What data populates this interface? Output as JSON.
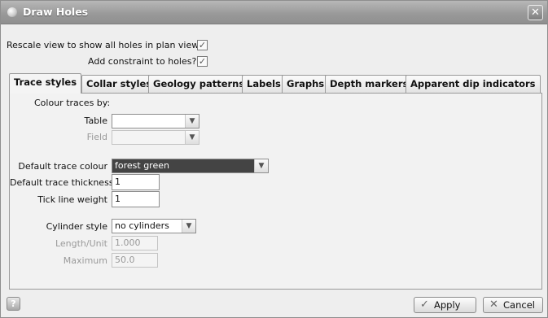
{
  "window": {
    "title": "Draw Holes",
    "close_glyph": "✕"
  },
  "options": {
    "rescale_label": "Rescale view to show all holes in plan view?",
    "rescale_checked": true,
    "constraint_label": "Add constraint to holes?",
    "constraint_checked": true,
    "check_glyph": "✓"
  },
  "tabs": [
    {
      "label": "Trace styles",
      "active": true
    },
    {
      "label": "Collar styles",
      "active": false
    },
    {
      "label": "Geology patterns",
      "active": false
    },
    {
      "label": "Labels",
      "active": false
    },
    {
      "label": "Graphs",
      "active": false
    },
    {
      "label": "Depth markers",
      "active": false
    },
    {
      "label": "Apparent dip indicators",
      "active": false
    }
  ],
  "trace": {
    "colour_by_label": "Colour traces by:",
    "table_label": "Table",
    "table_value": "",
    "field_label": "Field",
    "field_value": "",
    "default_colour_label": "Default trace colour",
    "default_colour_value": "forest green",
    "thickness_label": "Default trace thickness",
    "thickness_value": "1",
    "tick_label": "Tick line weight",
    "tick_value": "1",
    "cylinder_label": "Cylinder style",
    "cylinder_value": "no cylinders",
    "length_label": "Length/Unit",
    "length_value": "1.000",
    "maximum_label": "Maximum",
    "maximum_value": "50.0"
  },
  "footer": {
    "help_glyph": "?",
    "apply_label": "Apply",
    "apply_glyph": "✓",
    "cancel_label": "Cancel",
    "cancel_glyph": "✕"
  }
}
